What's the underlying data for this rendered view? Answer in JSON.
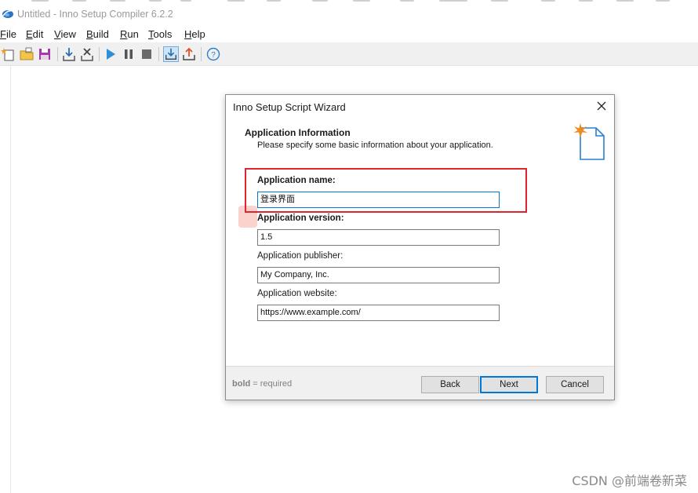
{
  "window": {
    "title": "Untitled - Inno Setup Compiler 6.2.2"
  },
  "menu": {
    "items": [
      {
        "first": "F",
        "rest": "ile"
      },
      {
        "first": "E",
        "rest": "dit"
      },
      {
        "first": "V",
        "rest": "iew"
      },
      {
        "first": "B",
        "rest": "uild"
      },
      {
        "first": "R",
        "rest": "un"
      },
      {
        "first": "T",
        "rest": "ools"
      },
      {
        "first": "H",
        "rest": "elp"
      }
    ]
  },
  "toolbar": {
    "buttons": [
      "new-file-icon",
      "open-folder-icon",
      "save-icon",
      "compile-icon",
      "stop-compile-icon",
      "run-icon",
      "pause-icon",
      "stop-icon",
      "download-icon",
      "upload-icon",
      "help-icon"
    ]
  },
  "dialog": {
    "title": "Inno Setup Script Wizard",
    "heading": "Application Information",
    "subheading": "Please specify some basic information about your application.",
    "fields": {
      "app_name": {
        "label": "Application name:",
        "value": "登录界面"
      },
      "app_version": {
        "label": "Application version:",
        "value": "1.5"
      },
      "app_publisher": {
        "label": "Application publisher:",
        "value": "My Company, Inc."
      },
      "app_website": {
        "label": "Application website:",
        "value": "https://www.example.com/"
      }
    },
    "footer_note_bold": "bold",
    "footer_note_rest": " = required",
    "buttons": {
      "back": "Back",
      "next": "Next",
      "cancel": "Cancel"
    }
  },
  "watermark": "CSDN @前端卷新菜",
  "colors": {
    "accent": "#0078d7",
    "highlight": "#e0232e"
  }
}
